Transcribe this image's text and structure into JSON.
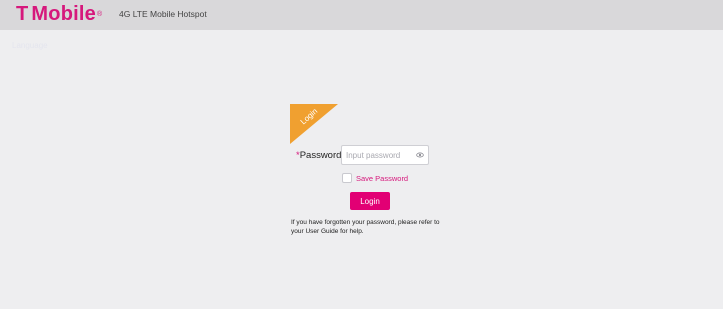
{
  "header": {
    "brand": "Mobile",
    "brand_mark": "T",
    "brand_tm": "®",
    "product_name": "4G LTE Mobile Hotspot"
  },
  "faint_link": "Language",
  "login_panel": {
    "corner_label": "Login",
    "password_required_mark": "*",
    "password_label": "Password",
    "password_placeholder": "Input password",
    "password_value": "",
    "show_password_icon": "eye-icon",
    "save_password_label": "Save Password",
    "save_password_checked": false,
    "login_button_label": "Login",
    "help_text": "If you have forgotten your password, please refer to your User Guide for help."
  },
  "colors": {
    "brand_magenta": "#e20074",
    "corner_orange": "#f0a030",
    "header_bg": "#d9d8da",
    "page_bg": "#eeeef0"
  }
}
